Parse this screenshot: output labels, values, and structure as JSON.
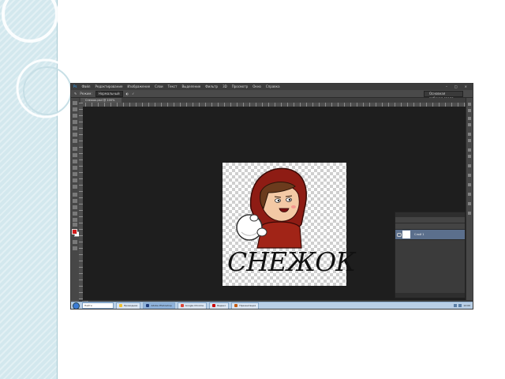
{
  "app": {
    "menu_items": [
      "Файл",
      "Редактирование",
      "Изображение",
      "Слои",
      "Текст",
      "Выделение",
      "Фильтр",
      "3D",
      "Просмотр",
      "Окно",
      "Справка"
    ],
    "options_bar": {
      "mode_label": "Режим:",
      "mode_value": "Нормальный",
      "workspace_value": "Основная рабочая среда"
    },
    "document_tab": "Снежок.psd @ 100%",
    "status_text": "100%"
  },
  "canvas": {
    "caption": "СНЕЖОК"
  },
  "layers_panel": {
    "layer_name": "Слой 1"
  },
  "taskbar": {
    "search_placeholder": "Найти",
    "buttons": [
      {
        "label": "Проводник",
        "color": "#f1c232"
      },
      {
        "label": "Adobe Photoshop",
        "color": "#1f3d7a"
      },
      {
        "label": "Google Chrome",
        "color": "#db4437"
      },
      {
        "label": "Яндекс",
        "color": "#cc0000"
      },
      {
        "label": "Презентация",
        "color": "#c55a11"
      }
    ],
    "clock": "12:00"
  },
  "colors": {
    "foreground": "#d21b1b",
    "background": "#ffffff",
    "accent": "#5b6f8c"
  }
}
